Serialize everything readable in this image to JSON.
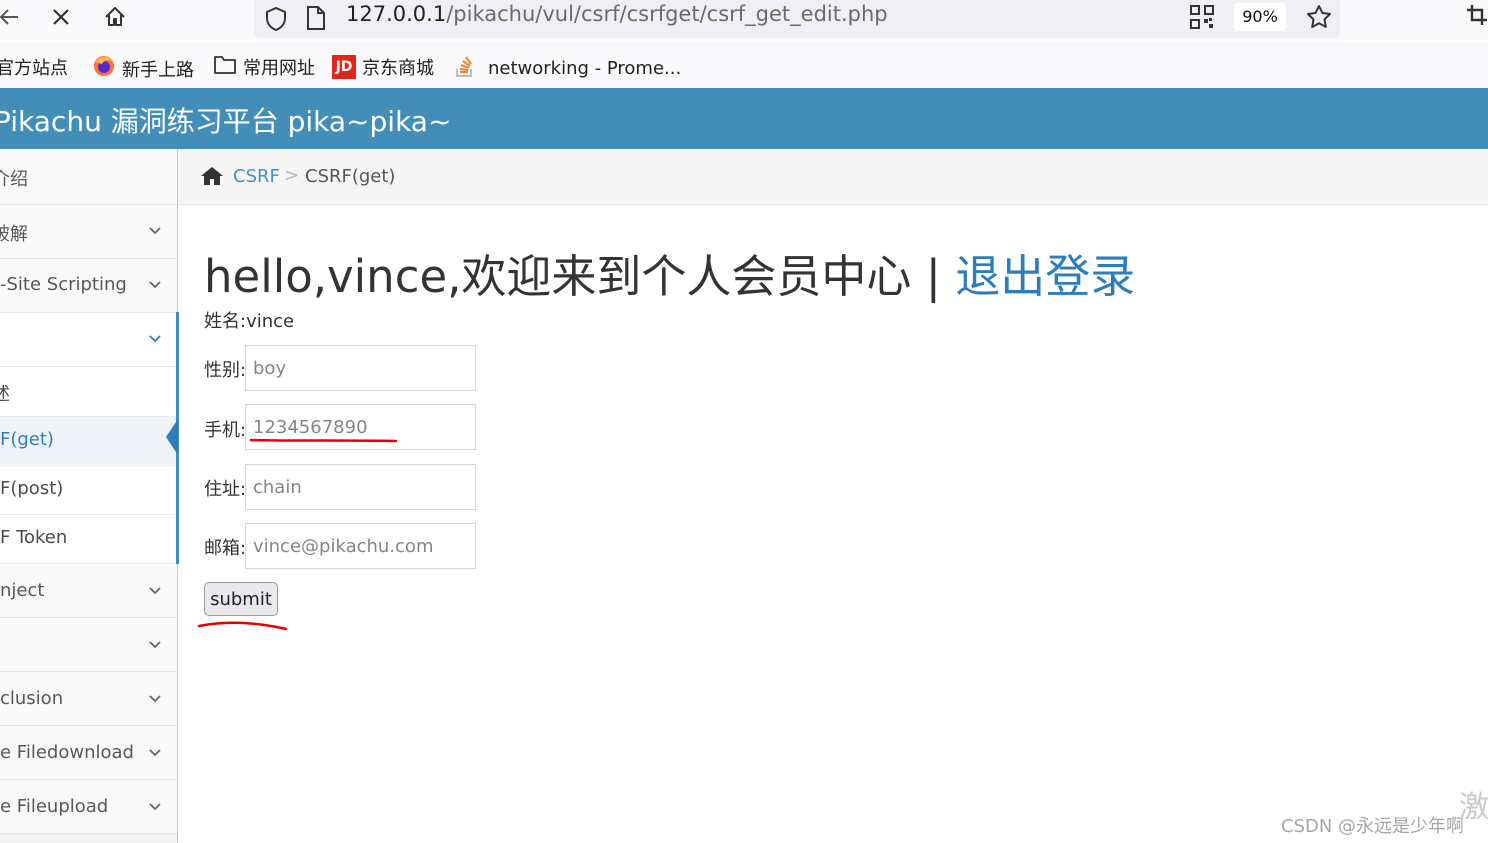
{
  "browser": {
    "url_main": "127.0.0.1",
    "url_path": "/pikachu/vul/csrf/csrfget/csrf_get_edit.php",
    "zoom": "90%",
    "bookmarks": [
      {
        "label": "官方站点"
      },
      {
        "label": "新手上路"
      },
      {
        "label": "常用网址"
      },
      {
        "label": "京东商城",
        "icon_text": "JD"
      },
      {
        "label": "networking - Prome..."
      }
    ]
  },
  "site": {
    "title": "Pikachu 漏洞练习平台 pika~pika~"
  },
  "sidebar": {
    "items": [
      {
        "label": "介绍"
      },
      {
        "label": "破解"
      },
      {
        "label": "-Site Scripting"
      },
      {
        "label": ""
      },
      {
        "label": "述"
      },
      {
        "label": "F(get)"
      },
      {
        "label": "F(post)"
      },
      {
        "label": "F Token"
      },
      {
        "label": "nject"
      },
      {
        "label": ""
      },
      {
        "label": "clusion"
      },
      {
        "label": "e Filedownload"
      },
      {
        "label": "e Fileupload"
      }
    ]
  },
  "breadcrumb": {
    "link": "CSRF",
    "separator": ">",
    "current": "CSRF(get)"
  },
  "main": {
    "greeting": "hello,vince,欢迎来到个人会员中心 | ",
    "logout": "退出登录",
    "name_line": "姓名:vince",
    "fields": [
      {
        "label": "性别:",
        "value": "boy"
      },
      {
        "label": "手机:",
        "value": "1234567890"
      },
      {
        "label": "住址:",
        "value": "chain"
      },
      {
        "label": "邮箱:",
        "value": "vince@pikachu.com"
      }
    ],
    "submit_label": "submit"
  },
  "watermark": "CSDN @永远是少年啊",
  "corner_mark": "激",
  "colors": {
    "header": "#438eb9",
    "link": "#2b7dbc",
    "annotation": "#e60000"
  }
}
